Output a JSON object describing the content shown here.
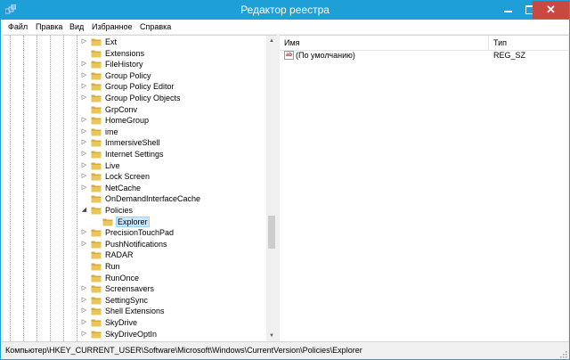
{
  "window": {
    "title": "Редактор реестра",
    "titlebar_color": "#1e9fd8",
    "close_color": "#c7493f",
    "close_glyph": "✕"
  },
  "menu": [
    {
      "label": "Файл"
    },
    {
      "label": "Правка"
    },
    {
      "label": "Вид"
    },
    {
      "label": "Избранное"
    },
    {
      "label": "Справка"
    }
  ],
  "tree": {
    "items": [
      {
        "label": "Ext",
        "expander": "▷"
      },
      {
        "label": "Extensions",
        "expander": ""
      },
      {
        "label": "FileHistory",
        "expander": "▷"
      },
      {
        "label": "Group Policy",
        "expander": "▷"
      },
      {
        "label": "Group Policy Editor",
        "expander": "▷"
      },
      {
        "label": "Group Policy Objects",
        "expander": "▷"
      },
      {
        "label": "GrpConv",
        "expander": ""
      },
      {
        "label": "HomeGroup",
        "expander": "▷"
      },
      {
        "label": "ime",
        "expander": "▷"
      },
      {
        "label": "ImmersiveShell",
        "expander": "▷"
      },
      {
        "label": "Internet Settings",
        "expander": "▷"
      },
      {
        "label": "Live",
        "expander": "▷"
      },
      {
        "label": "Lock Screen",
        "expander": "▷"
      },
      {
        "label": "NetCache",
        "expander": "▷"
      },
      {
        "label": "OnDemandInterfaceCache",
        "expander": ""
      },
      {
        "label": "Policies",
        "expander": "◢"
      },
      {
        "label": "Explorer",
        "expander": "",
        "child": true,
        "selected": true
      },
      {
        "label": "PrecisionTouchPad",
        "expander": "▷"
      },
      {
        "label": "PushNotifications",
        "expander": "▷"
      },
      {
        "label": "RADAR",
        "expander": ""
      },
      {
        "label": "Run",
        "expander": ""
      },
      {
        "label": "RunOnce",
        "expander": ""
      },
      {
        "label": "Screensavers",
        "expander": "▷"
      },
      {
        "label": "SettingSync",
        "expander": "▷"
      },
      {
        "label": "Shell Extensions",
        "expander": "▷"
      },
      {
        "label": "SkyDrive",
        "expander": "▷"
      },
      {
        "label": "SkyDriveOptIn",
        "expander": "▷"
      }
    ],
    "scroll_up_glyph": "▲",
    "scroll_down_glyph": "▼"
  },
  "list": {
    "columns": {
      "name": "Имя",
      "type": "Тип"
    },
    "values": [
      {
        "icon": "string-value-icon",
        "icon_text": "ab",
        "name": "(По умолчанию)",
        "type": "REG_SZ"
      }
    ]
  },
  "status": {
    "path": "Компьютер\\HKEY_CURRENT_USER\\Software\\Microsoft\\Windows\\CurrentVersion\\Policies\\Explorer"
  },
  "colors": {
    "selection": "#cce8ff",
    "folder": "#e8c65a"
  }
}
